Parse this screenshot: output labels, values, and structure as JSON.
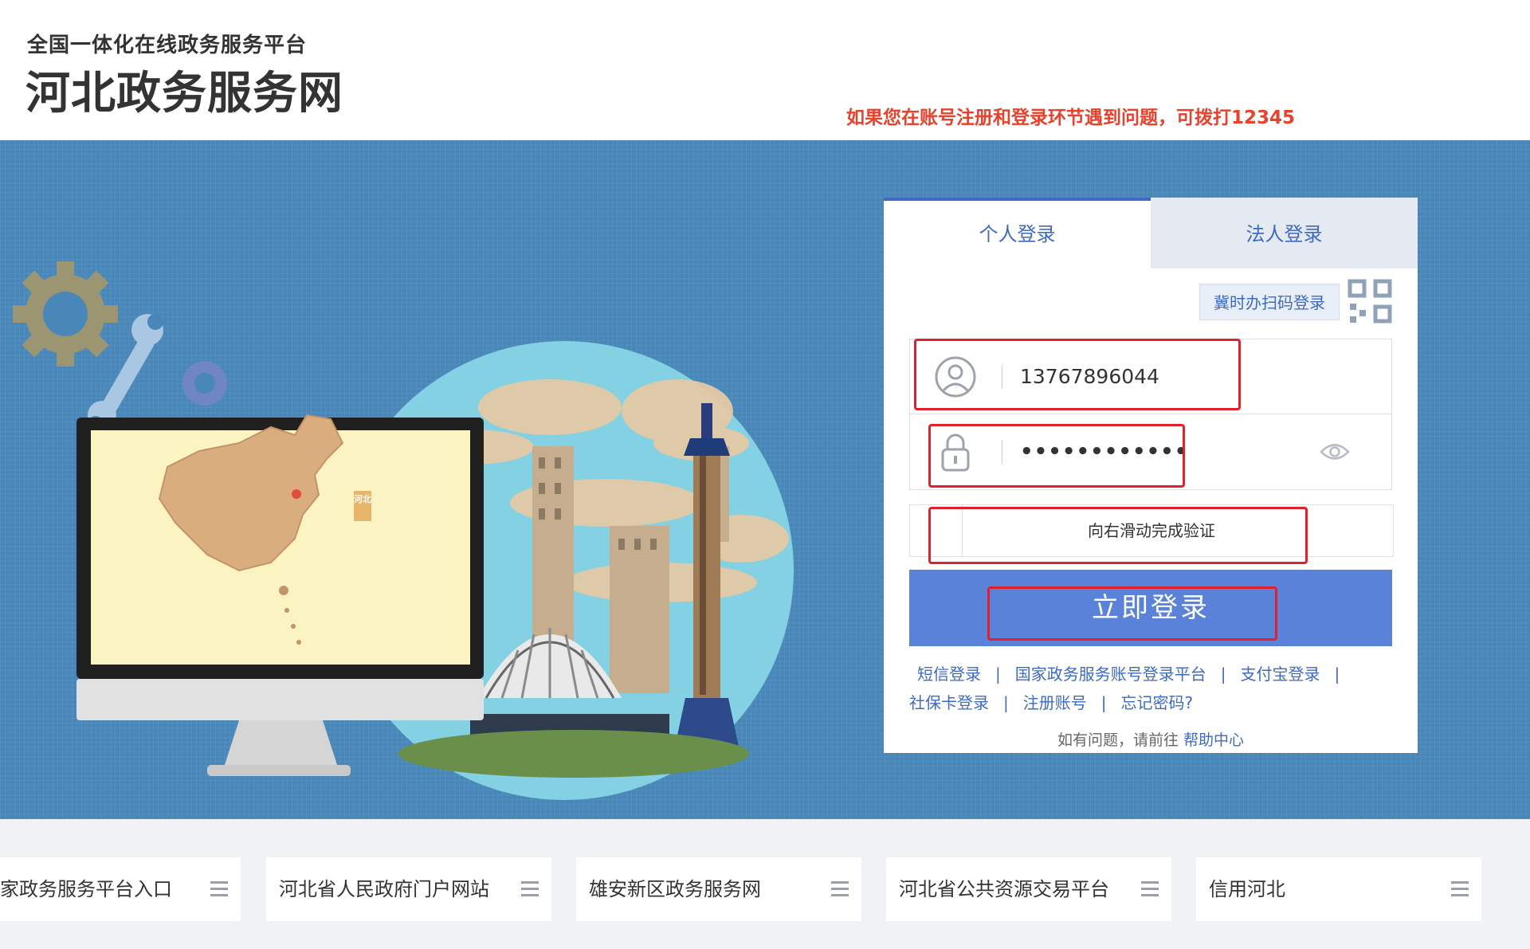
{
  "header": {
    "subtitle": "全国一体化在线政务服务平台",
    "title": "河北政务服务网",
    "hotline_notice": "如果您在账号注册和登录环节遇到问题，可拨打12345"
  },
  "banner": {
    "map_badge": "河北"
  },
  "login": {
    "tabs": [
      {
        "label": "个人登录",
        "active": true
      },
      {
        "label": "法人登录",
        "active": false
      }
    ],
    "qr_login_label": "冀时办扫码登录",
    "username_value": "13767896044",
    "password_value": "••••••••••••",
    "slider_text": "向右滑动完成验证",
    "submit_label": "立即登录",
    "links": {
      "sms": "短信登录",
      "national": "国家政务服务账号登录平台",
      "alipay": "支付宝登录",
      "social_card": "社保卡登录",
      "register": "注册账号",
      "forgot": "忘记密码?"
    },
    "help_prefix": "如有问题，请前往",
    "help_link": "帮助中心"
  },
  "footer": {
    "links": [
      "家政务服务平台入口",
      "河北省人民政府门户网站",
      "雄安新区政务服务网",
      "河北省公共资源交易平台",
      "信用河北"
    ]
  },
  "colors": {
    "accent": "#3e6ac4",
    "button": "#5b82d9",
    "banner_bg": "#4a87b9",
    "notice_red": "#e8412c",
    "annotation_red": "#e0212b"
  }
}
